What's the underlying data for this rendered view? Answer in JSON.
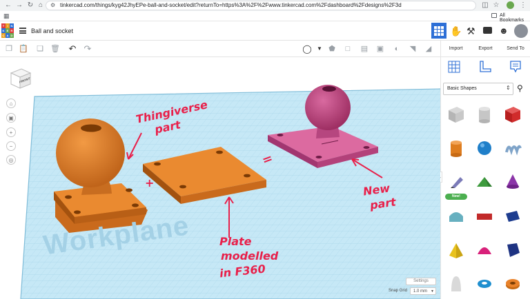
{
  "browser": {
    "url": "tinkercad.com/things/kyg42JhyEPe-ball-and-socket/edit?returnTo=https%3A%2F%2Fwww.tinkercad.com%2Fdashboard%2Fdesigns%2F3d",
    "all_bookmarks": "All Bookmarks"
  },
  "app": {
    "logo_letters": [
      "TIN",
      "KER",
      "CAD"
    ],
    "design_title": "Ball and socket"
  },
  "panel": {
    "import": "Import",
    "export": "Export",
    "send_to": "Send To",
    "shape_library": "Basic Shapes",
    "new_badge": "New!"
  },
  "viewport": {
    "viewcube_face": "FRONT",
    "workplane_label": "Workplane",
    "settings": "Settings",
    "snap_grid_label": "Snap Grid",
    "snap_grid_value": "1.0 mm"
  },
  "annotations": {
    "thingiverse": "Thingiverse",
    "part1": "part",
    "plus": "+",
    "equals": "=",
    "new": "New",
    "part2": "part",
    "plate1": "Plate",
    "plate2": "modelled",
    "plate3": "in F360"
  },
  "colors": {
    "orange_part": "#e9822a",
    "pink_part": "#d95a96",
    "annotation_red": "#e8204a",
    "workplane_blue": "#b9e1f2",
    "accent_blue": "#2d6fd6"
  }
}
